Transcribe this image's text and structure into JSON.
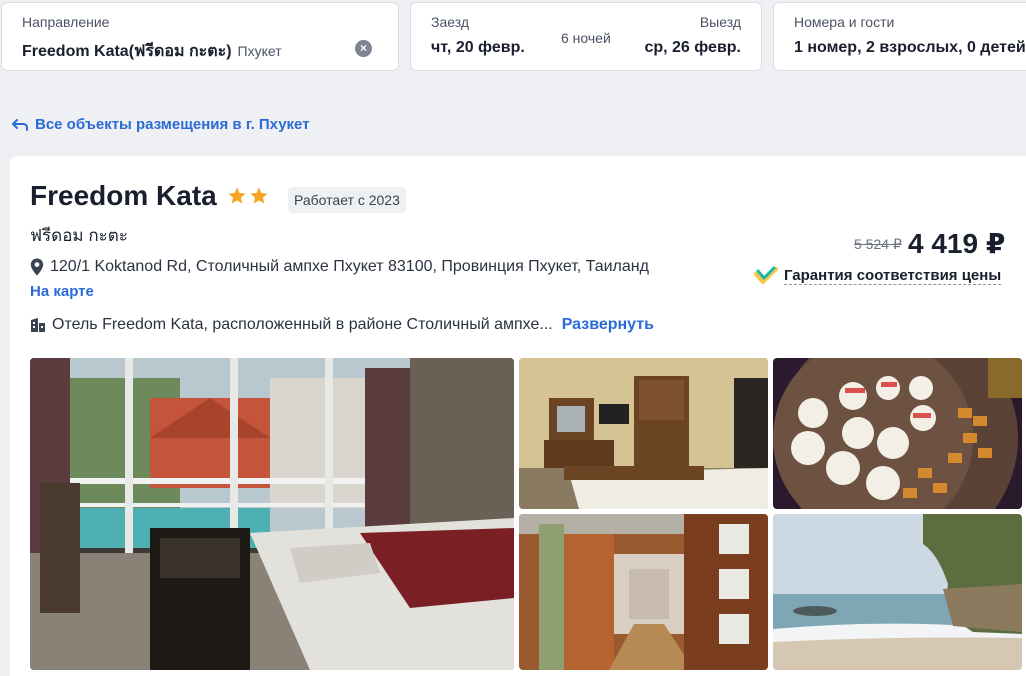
{
  "search": {
    "destination": {
      "label": "Направление",
      "value": "Freedom Kata(ฟรีดอม กะตะ)",
      "city": "Пхукет"
    },
    "checkin": {
      "label": "Заезд",
      "value": "чт, 20 февр."
    },
    "nights": "6 ночей",
    "checkout": {
      "label": "Выезд",
      "value": "ср, 26 февр."
    },
    "guests": {
      "label": "Номера и гости",
      "value": "1 номер, 2 взрослых, 0 детей"
    }
  },
  "back_link": "Все объекты размещения в г. Пхукет",
  "hotel": {
    "name": "Freedom Kata",
    "stars": 2,
    "since_badge": "Работает с 2023",
    "native_name": "ฟรีดอม กะตะ",
    "address": "120/1 Koktanod Rd, Столичный ампхе Пхукет 83100, Провинция Пхукет, Таиланд",
    "map_link": "На карте",
    "description": "Отель Freedom Kata, расположенный в районе Столичный ампхе...",
    "expand_link": "Развернуть"
  },
  "pricing": {
    "old_price": "5 524 ₽",
    "price": "4 419 ₽",
    "guarantee": "Гарантия соответствия цены"
  },
  "colors": {
    "accent": "#2a6bd6",
    "star": "#f5a623",
    "guarantee_teal": "#1fb5a3",
    "guarantee_yellow": "#f7c948"
  },
  "icons": [
    "clear-icon",
    "back-arrow-icon",
    "star-icon",
    "map-pin-icon",
    "building-icon",
    "guarantee-check-icon"
  ]
}
